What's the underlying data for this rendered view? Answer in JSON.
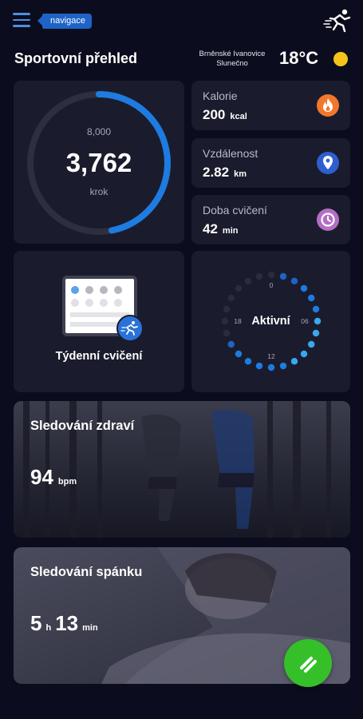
{
  "header": {
    "nav_label": "navigace",
    "page_title": "Sportovní přehled",
    "location_line1": "Brněnské Ivanovice",
    "location_line2": "Slunečno",
    "temperature": "18°C"
  },
  "steps": {
    "goal": "8,000",
    "value": "3,762",
    "unit": "krok",
    "progress": 0.47
  },
  "stats": [
    {
      "label": "Kalorie",
      "value": "200",
      "unit": "kcal",
      "icon": "fire-icon",
      "color": "#f3772a"
    },
    {
      "label": "Vzdálenost",
      "value": "2.82",
      "unit": "km",
      "icon": "location-pin-icon",
      "color": "#2f5fcf"
    },
    {
      "label": "Doba cvičení",
      "value": "42",
      "unit": "min",
      "icon": "clock-icon",
      "color": "#b46ec4"
    }
  ],
  "weekly": {
    "label": "Týdenní cvičení"
  },
  "active": {
    "label": "Aktivní",
    "ticks": [
      "0",
      "06",
      "12",
      "18"
    ]
  },
  "health": {
    "title": "Sledování zdraví",
    "value": "94",
    "unit": "bpm"
  },
  "sleep": {
    "title": "Sledování spánku",
    "hours": "5",
    "hours_unit": "h",
    "minutes": "13",
    "minutes_unit": "min"
  },
  "colors": {
    "accent": "#1e7be0",
    "background": "#0b0d1e",
    "card": "#1a1c2d",
    "fab": "#35c02a"
  }
}
